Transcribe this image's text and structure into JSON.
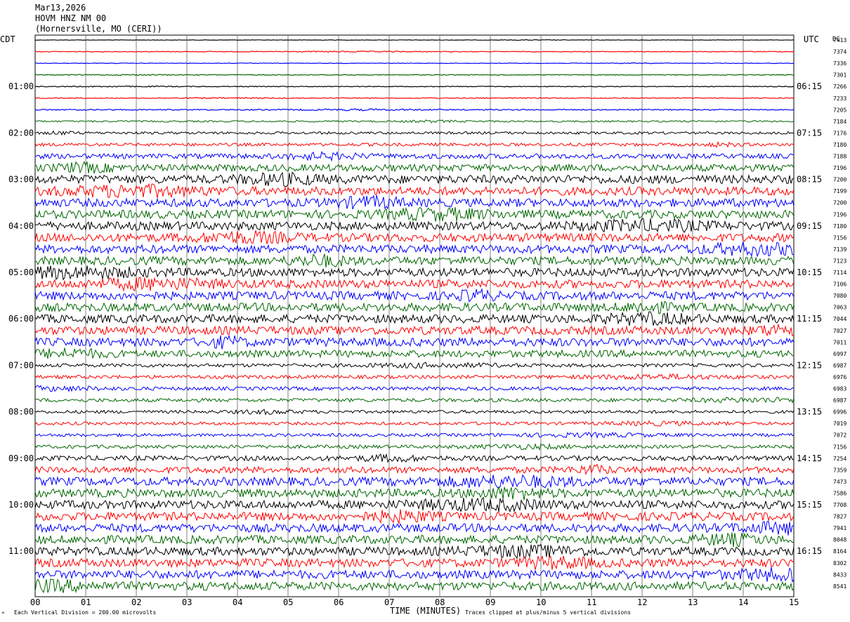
{
  "header": {
    "date": "Mar13,2026",
    "station": "HOVM HNZ NM 00",
    "location": "(Hornersville, MO (CERI))"
  },
  "footer": {
    "scale_note": "Each Vertical Division =  200.00 microvolts",
    "clip_note": "Traces clipped at plus/minus 5 vertical divisions",
    "corner_mark": "ᴹ"
  },
  "chart_data": {
    "type": "line",
    "title": "",
    "xlabel": "TIME (MINUTES)",
    "ylabel_left": "CDT",
    "ylabel_right": "UTC",
    "dc_label": "DC",
    "xlim": [
      0,
      15
    ],
    "x_ticks": [
      "00",
      "01",
      "02",
      "03",
      "04",
      "05",
      "06",
      "07",
      "08",
      "09",
      "10",
      "11",
      "12",
      "13",
      "14",
      "15"
    ],
    "trace_minutes": 15,
    "traces_per_hour": 4,
    "colors": [
      "#000000",
      "#ff0000",
      "#0000ff",
      "#006600"
    ],
    "left_hour_labels": [
      {
        "trace": 4,
        "text": "01:00"
      },
      {
        "trace": 8,
        "text": "02:00"
      },
      {
        "trace": 12,
        "text": "03:00"
      },
      {
        "trace": 16,
        "text": "04:00"
      },
      {
        "trace": 20,
        "text": "05:00"
      },
      {
        "trace": 24,
        "text": "06:00"
      },
      {
        "trace": 28,
        "text": "07:00"
      },
      {
        "trace": 32,
        "text": "08:00"
      },
      {
        "trace": 36,
        "text": "09:00"
      },
      {
        "trace": 40,
        "text": "10:00"
      },
      {
        "trace": 44,
        "text": "11:00"
      }
    ],
    "right_hour_labels": [
      {
        "trace": 4,
        "text": "06:15"
      },
      {
        "trace": 8,
        "text": "07:15"
      },
      {
        "trace": 12,
        "text": "08:15"
      },
      {
        "trace": 16,
        "text": "09:15"
      },
      {
        "trace": 20,
        "text": "10:15"
      },
      {
        "trace": 24,
        "text": "11:15"
      },
      {
        "trace": 28,
        "text": "12:15"
      },
      {
        "trace": 32,
        "text": "13:15"
      },
      {
        "trace": 36,
        "text": "14:15"
      },
      {
        "trace": 40,
        "text": "15:15"
      },
      {
        "trace": 44,
        "text": "16:15"
      }
    ],
    "dc_offsets": [
      "7413",
      "7374",
      "7336",
      "7301",
      "7266",
      "7233",
      "7205",
      "7184",
      "7176",
      "7180",
      "7188",
      "7196",
      "7200",
      "7199",
      "7200",
      "7196",
      "7180",
      "7156",
      "7139",
      "7123",
      "7114",
      "7106",
      "7080",
      "7063",
      "7044",
      "7027",
      "7011",
      "6997",
      "6987",
      "6976",
      "6983",
      "6987",
      "6996",
      "7019",
      "7072",
      "7156",
      "7254",
      "7359",
      "7473",
      "7586",
      "7708",
      "7827",
      "7941",
      "8048",
      "8164",
      "8302",
      "8433",
      "8541"
    ],
    "trace_amplitudes": [
      0.3,
      0.5,
      0.4,
      0.5,
      0.5,
      0.6,
      0.8,
      1.2,
      1.8,
      2.2,
      3.5,
      5.0,
      6.0,
      6.0,
      6.0,
      6.0,
      6.0,
      6.0,
      6.0,
      6.0,
      6.0,
      6.0,
      6.0,
      6.0,
      6.0,
      6.0,
      6.0,
      5.0,
      2.5,
      2.5,
      2.5,
      2.5,
      2.2,
      2.2,
      2.2,
      2.5,
      3.5,
      4.5,
      6.0,
      6.0,
      6.0,
      6.0,
      6.0,
      6.0,
      6.0,
      6.0,
      6.0,
      6.0
    ]
  }
}
